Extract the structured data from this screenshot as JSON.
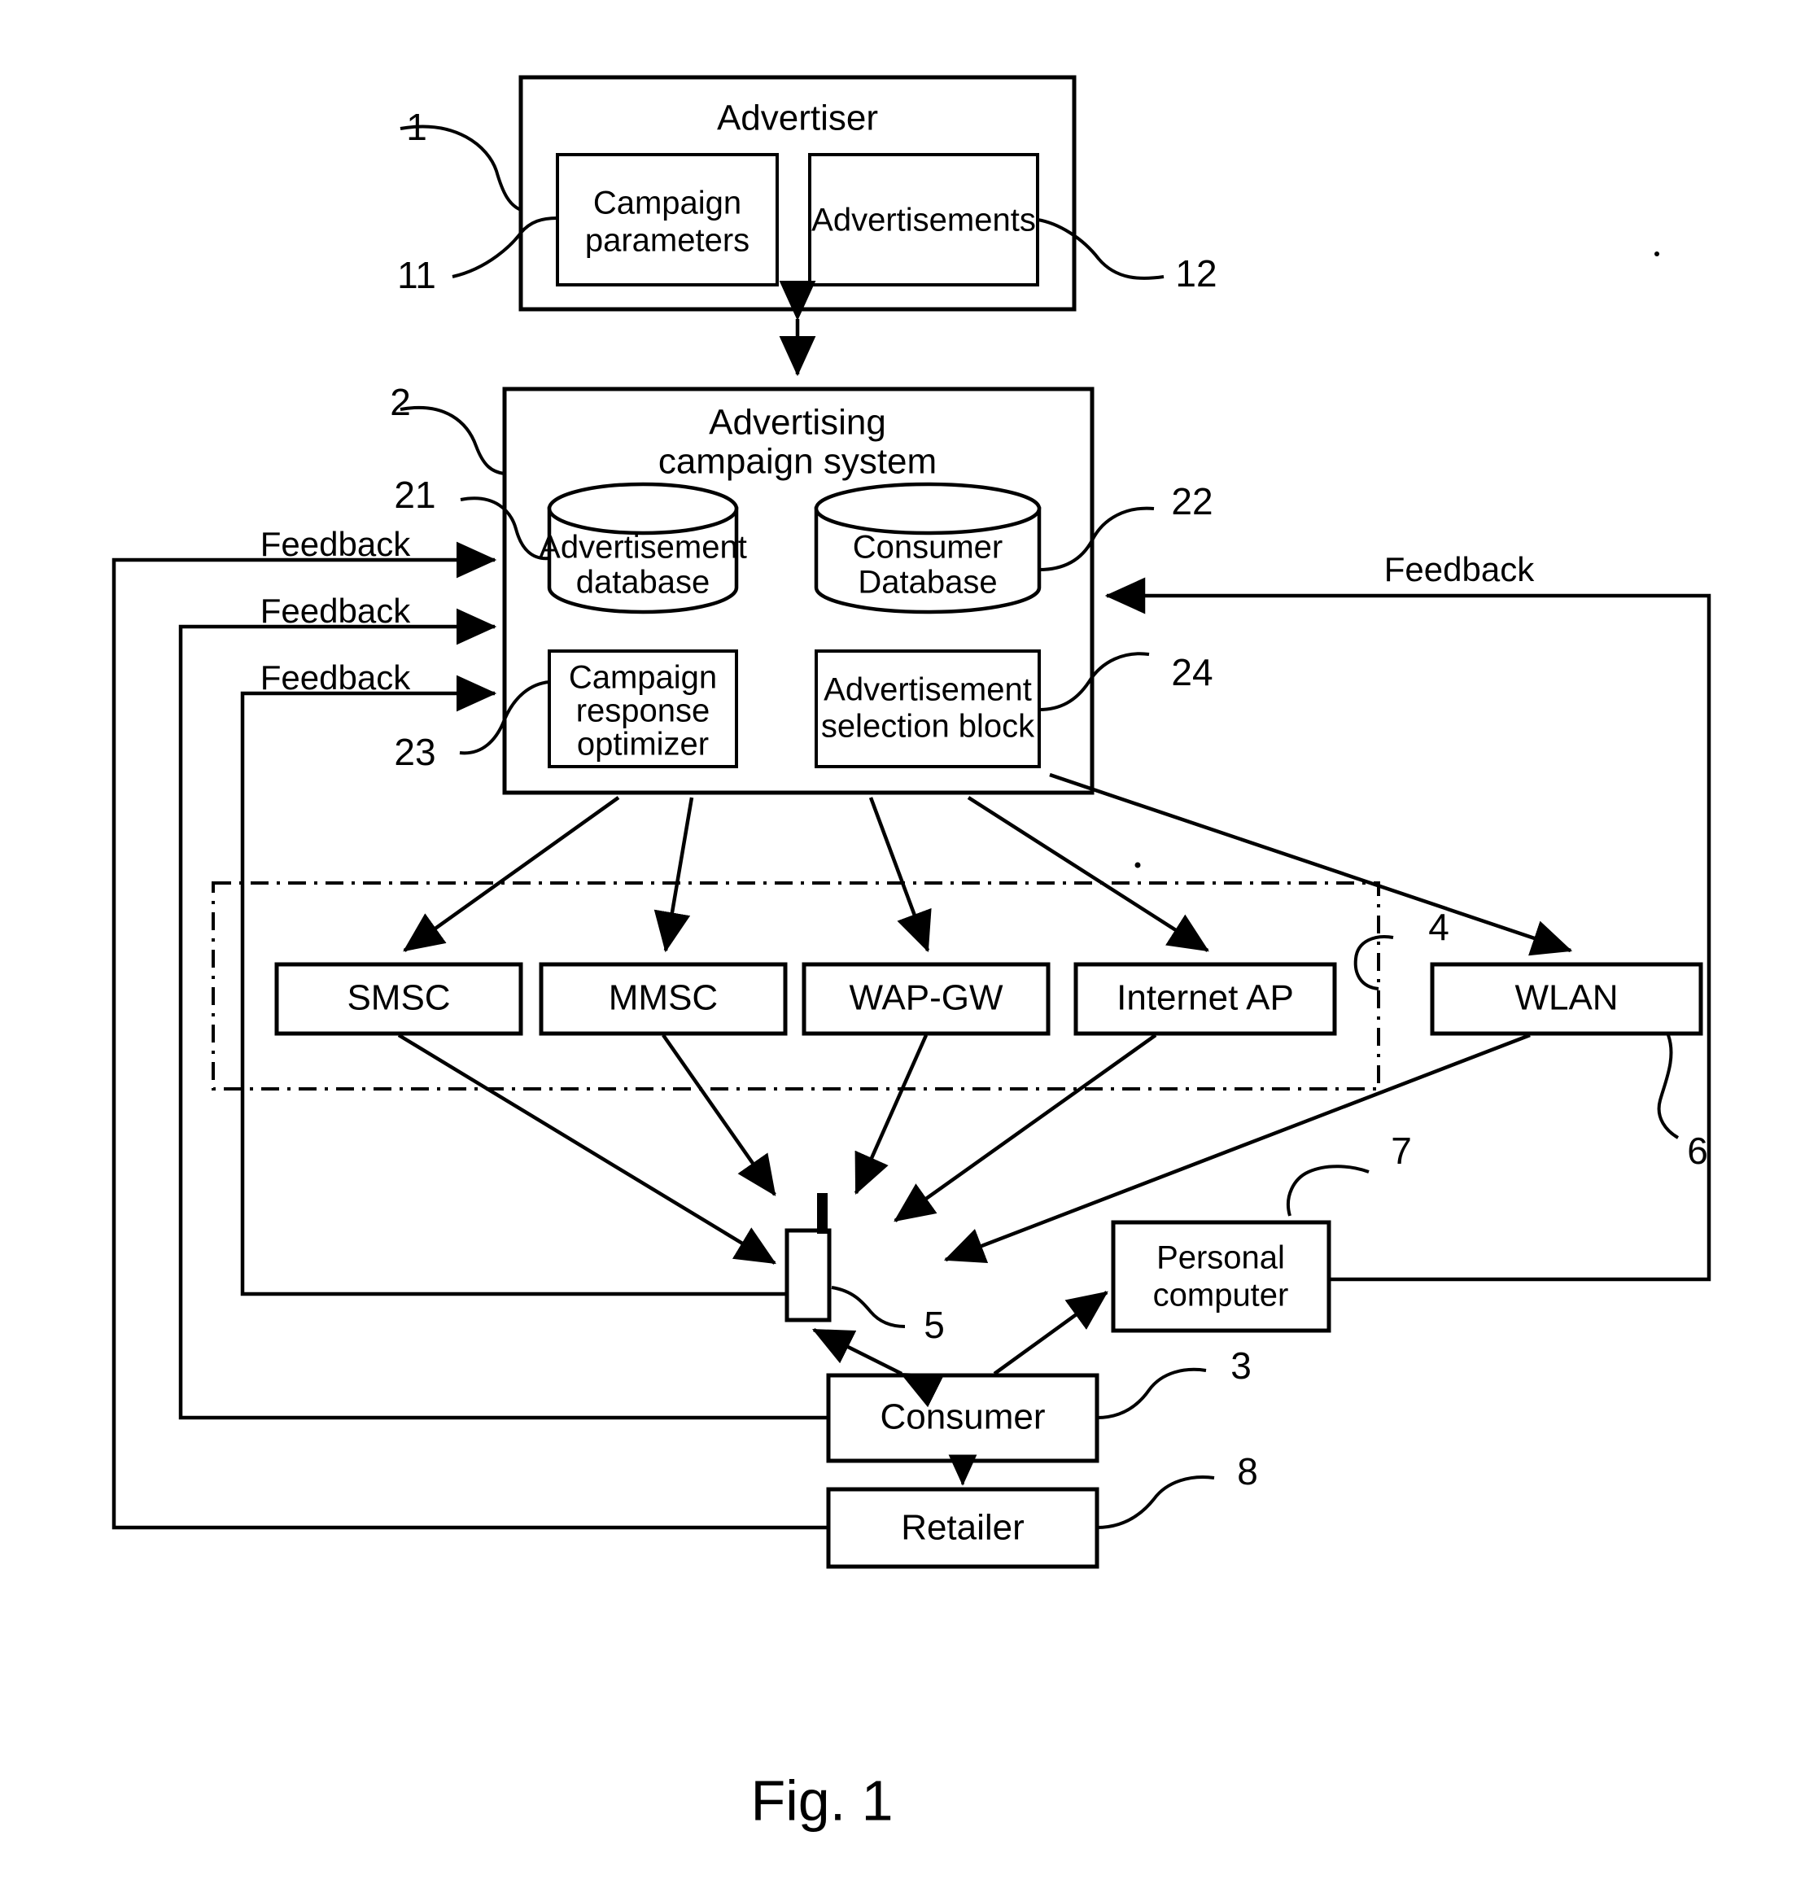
{
  "figure": {
    "caption": "Fig. 1",
    "type": "patent-block-diagram"
  },
  "nodes": {
    "advertiser": {
      "label": "Advertiser",
      "ref": "1",
      "children": {
        "campaign_parameters": {
          "label_line1": "Campaign",
          "label_line2": "parameters",
          "ref": "11"
        },
        "advertisements": {
          "label": "Advertisements",
          "ref": "12"
        }
      }
    },
    "campaign_system": {
      "label_line1": "Advertising",
      "label_line2": "campaign system",
      "ref": "2",
      "children": {
        "advertisement_database": {
          "label_line1": "Advertisement",
          "label_line2": "database",
          "ref": "21",
          "shape": "cylinder"
        },
        "consumer_database": {
          "label_line1": "Consumer",
          "label_line2": "Database",
          "ref": "22",
          "shape": "cylinder"
        },
        "campaign_response_optimizer": {
          "label_line1": "Campaign",
          "label_line2": "response",
          "label_line3": "optimizer",
          "ref": "23",
          "shape": "rect"
        },
        "advertisement_selection_block": {
          "label_line1": "Advertisement",
          "label_line2": "selection block",
          "ref": "24",
          "shape": "rect"
        }
      }
    },
    "bearer_group": {
      "ref": "4",
      "style": "dash-dot-enclosure",
      "members": [
        {
          "label": "SMSC"
        },
        {
          "label": "MMSC"
        },
        {
          "label": "WAP-GW"
        },
        {
          "label": "Internet AP"
        }
      ]
    },
    "wlan": {
      "label": "WLAN",
      "ref": "6"
    },
    "mobile_terminal": {
      "label": "",
      "ref": "5",
      "shape": "terminal-with-antenna"
    },
    "personal_computer": {
      "label_line1": "Personal",
      "label_line2": "computer",
      "ref": "7"
    },
    "consumer": {
      "label": "Consumer",
      "ref": "3"
    },
    "retailer": {
      "label": "Retailer",
      "ref": "8"
    }
  },
  "edges": {
    "feedback_labels": [
      {
        "text": "Feedback",
        "side": "left",
        "row": 1
      },
      {
        "text": "Feedback",
        "side": "left",
        "row": 2
      },
      {
        "text": "Feedback",
        "side": "left",
        "row": 3
      },
      {
        "text": "Feedback",
        "side": "right",
        "row": 1
      }
    ]
  },
  "reference_numerals": [
    "1",
    "2",
    "3",
    "4",
    "5",
    "6",
    "7",
    "8",
    "11",
    "12",
    "21",
    "22",
    "23",
    "24"
  ],
  "colors": {
    "ink": "#000000",
    "paper": "#ffffff"
  }
}
